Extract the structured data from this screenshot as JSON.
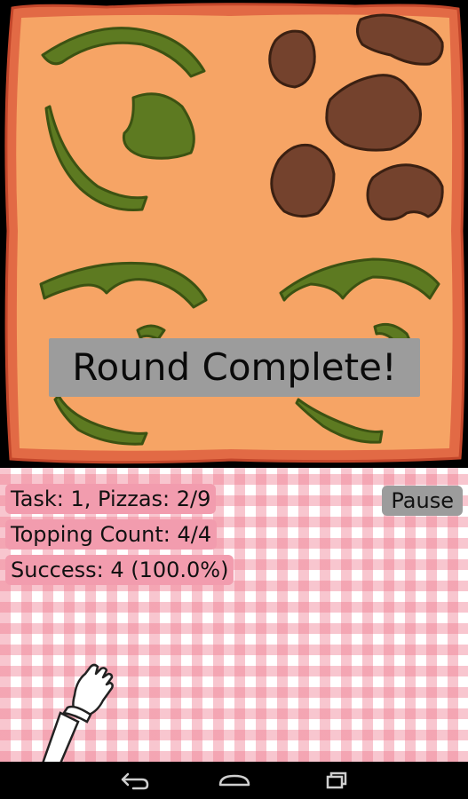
{
  "banner": {
    "text": "Round Complete!"
  },
  "stats": {
    "task_line": "Task: 1, Pizzas: 2/9",
    "topping_line": "Topping Count: 4/4",
    "success_line": "Success: 4 (100.0%)"
  },
  "controls": {
    "pause_label": "Pause"
  },
  "colors": {
    "crust": "#e26a45",
    "cheese": "#f6a465",
    "pepper": "#5d7a21",
    "pepper_dark": "#3c5212",
    "sausage": "#74422d",
    "checker_pink": "#ef788c",
    "label_pink": "#f29cae",
    "banner_gray": "#9c9c9c"
  },
  "icons": {
    "back": "back-arrow-icon",
    "home": "home-icon",
    "recents": "recents-icon"
  }
}
